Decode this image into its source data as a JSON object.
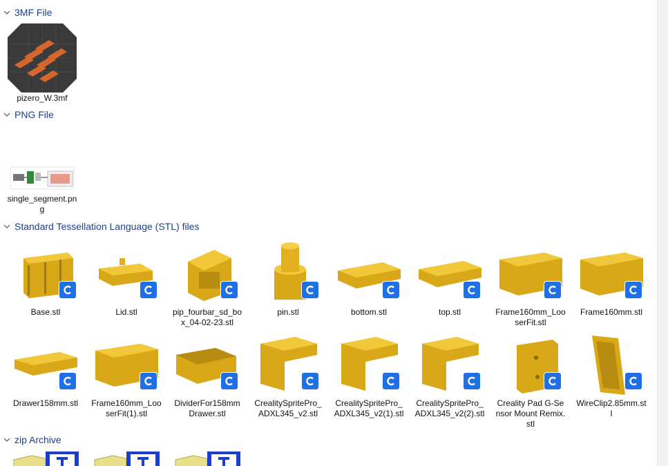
{
  "colors": {
    "header_text": "#1e3f8b",
    "model_yellow": "#e8b417",
    "badge_blue": "#1f6fe5"
  },
  "groups": [
    {
      "title": "3MF File",
      "icon": "chevron-down-icon"
    },
    {
      "title": "PNG File",
      "icon": "chevron-down-icon"
    },
    {
      "title": "Standard Tessellation Language (STL) files",
      "icon": "chevron-down-icon"
    },
    {
      "title": "zip Archive",
      "icon": "chevron-down-icon"
    }
  ],
  "files_3mf": [
    {
      "name": "pizero_W.3mf"
    }
  ],
  "files_png": [
    {
      "name": "single_segment.png"
    }
  ],
  "files_stl": [
    {
      "name": "Base.stl"
    },
    {
      "name": "Lid.stl"
    },
    {
      "name": "pip_fourbar_sd_box_04-02-23.stl"
    },
    {
      "name": "pin.stl"
    },
    {
      "name": "bottom.stl"
    },
    {
      "name": "top.stl"
    },
    {
      "name": "Frame160mm_LooserFit.stl"
    },
    {
      "name": "Frame160mm.stl"
    },
    {
      "name": "Drawer158mm.stl"
    },
    {
      "name": "Frame160mm_LooserFit(1).stl"
    },
    {
      "name": "DividerFor158mmDrawer.stl"
    },
    {
      "name": "CrealitySpritePro_ADXL345_v2.stl"
    },
    {
      "name": "CrealitySpritePro_ADXL345_v2(1).stl"
    },
    {
      "name": "CrealitySpritePro_ADXL345_v2(2).stl"
    },
    {
      "name": "Creality Pad G-Sensor Mount Remix.stl"
    },
    {
      "name": "WireClip2.85mm.stl"
    }
  ],
  "zip_items_visible": 3
}
